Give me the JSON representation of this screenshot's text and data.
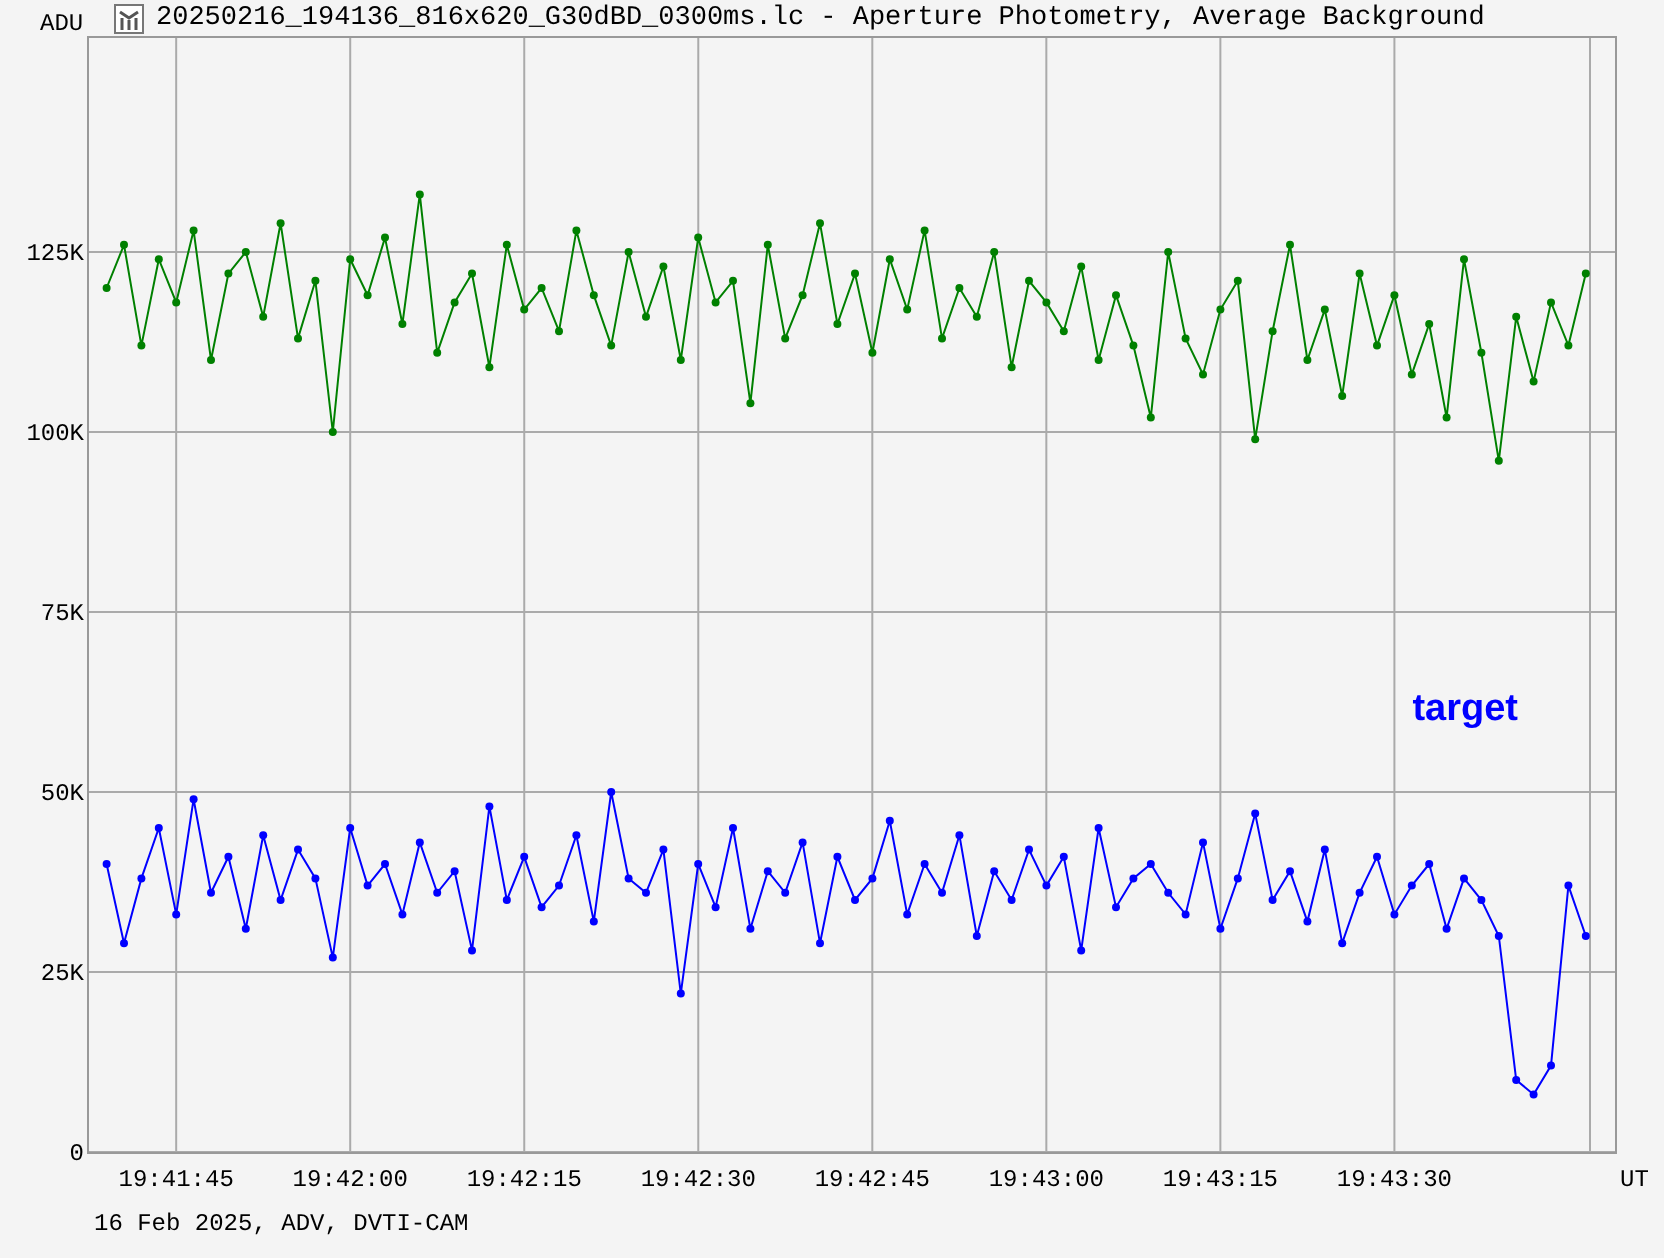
{
  "window": {
    "title": "20250216_194136_816x620_G30dBD_0300ms.lc - Aperture Photometry, Average Background"
  },
  "chart": {
    "chart_data": {
      "type": "line",
      "ylabel": "ADU",
      "xlabel": "UT",
      "grid": true,
      "xlim": [
        70897.4,
        71029.1
      ],
      "ylim": [
        0,
        155
      ],
      "xticks": [
        {
          "value": 70905,
          "label": "19:41:45"
        },
        {
          "value": 70920,
          "label": "19:42:00"
        },
        {
          "value": 70935,
          "label": "19:42:15"
        },
        {
          "value": 70950,
          "label": "19:42:30"
        },
        {
          "value": 70965,
          "label": "19:42:45"
        },
        {
          "value": 70980,
          "label": "19:43:00"
        },
        {
          "value": 70995,
          "label": "19:43:15"
        },
        {
          "value": 71010,
          "label": "19:43:30"
        }
      ],
      "yticks": [
        {
          "value": 0,
          "label": "0"
        },
        {
          "value": 25,
          "label": "25K"
        },
        {
          "value": 50,
          "label": "50K"
        },
        {
          "value": 75,
          "label": "75K"
        },
        {
          "value": 100,
          "label": "100K"
        },
        {
          "value": 125,
          "label": "125K"
        }
      ],
      "x": [
        70899,
        70900.5,
        70902,
        70903.5,
        70905,
        70906.5,
        70908,
        70909.5,
        70911,
        70912.5,
        70914,
        70915.5,
        70917,
        70918.5,
        70920,
        70921.5,
        70923,
        70924.5,
        70926,
        70927.5,
        70929,
        70930.5,
        70932,
        70933.5,
        70935,
        70936.5,
        70938,
        70939.5,
        70941,
        70942.5,
        70944,
        70945.5,
        70947,
        70948.5,
        70950,
        70951.5,
        70953,
        70954.5,
        70956,
        70957.5,
        70959,
        70960.5,
        70962,
        70963.5,
        70965,
        70966.5,
        70968,
        70969.5,
        70971,
        70972.5,
        70974,
        70975.5,
        70977,
        70978.5,
        70980,
        70981.5,
        70983,
        70984.5,
        70986,
        70987.5,
        70989,
        70990.5,
        70992,
        70993.5,
        70995,
        70996.5,
        70998,
        70999.5,
        71001,
        71002.5,
        71004,
        71005.5,
        71007,
        71008.5,
        71010,
        71011.5,
        71013,
        71014.5,
        71016,
        71017.5,
        71019,
        71020.5,
        71022,
        71023.5,
        71025,
        71026.5
      ],
      "series": [
        {
          "color": "#008000",
          "marker": "dot",
          "values": [
            120,
            126,
            112,
            124,
            118,
            128,
            110,
            122,
            125,
            116,
            129,
            113,
            121,
            100,
            124,
            119,
            127,
            115,
            133,
            111,
            118,
            122,
            109,
            126,
            117,
            120,
            114,
            128,
            119,
            112,
            125,
            116,
            123,
            110,
            127,
            118,
            121,
            104,
            126,
            113,
            119,
            129,
            115,
            122,
            111,
            124,
            117,
            128,
            113,
            120,
            116,
            125,
            109,
            121,
            118,
            114,
            123,
            110,
            119,
            112,
            102,
            125,
            113,
            108,
            117,
            121,
            99,
            114,
            126,
            110,
            117,
            105,
            122,
            112,
            119,
            108,
            115,
            102,
            124,
            111,
            96,
            116,
            107,
            118,
            112,
            122
          ]
        },
        {
          "name": "target",
          "color": "#0000ff",
          "marker": "dot",
          "values": [
            40,
            29,
            38,
            45,
            33,
            49,
            36,
            41,
            31,
            44,
            35,
            42,
            38,
            27,
            45,
            37,
            40,
            33,
            43,
            36,
            39,
            28,
            48,
            35,
            41,
            34,
            37,
            44,
            32,
            50,
            38,
            36,
            42,
            22,
            40,
            34,
            45,
            31,
            39,
            36,
            43,
            29,
            41,
            35,
            38,
            46,
            33,
            40,
            36,
            44,
            30,
            39,
            35,
            42,
            37,
            41,
            28,
            45,
            34,
            38,
            40,
            36,
            33,
            43,
            31,
            38,
            47,
            35,
            39,
            32,
            42,
            29,
            36,
            41,
            33,
            37,
            40,
            31,
            38,
            35,
            30,
            10,
            8,
            12,
            37,
            30
          ]
        }
      ]
    }
  },
  "footer": "16 Feb 2025, ADV, DVTI-CAM"
}
